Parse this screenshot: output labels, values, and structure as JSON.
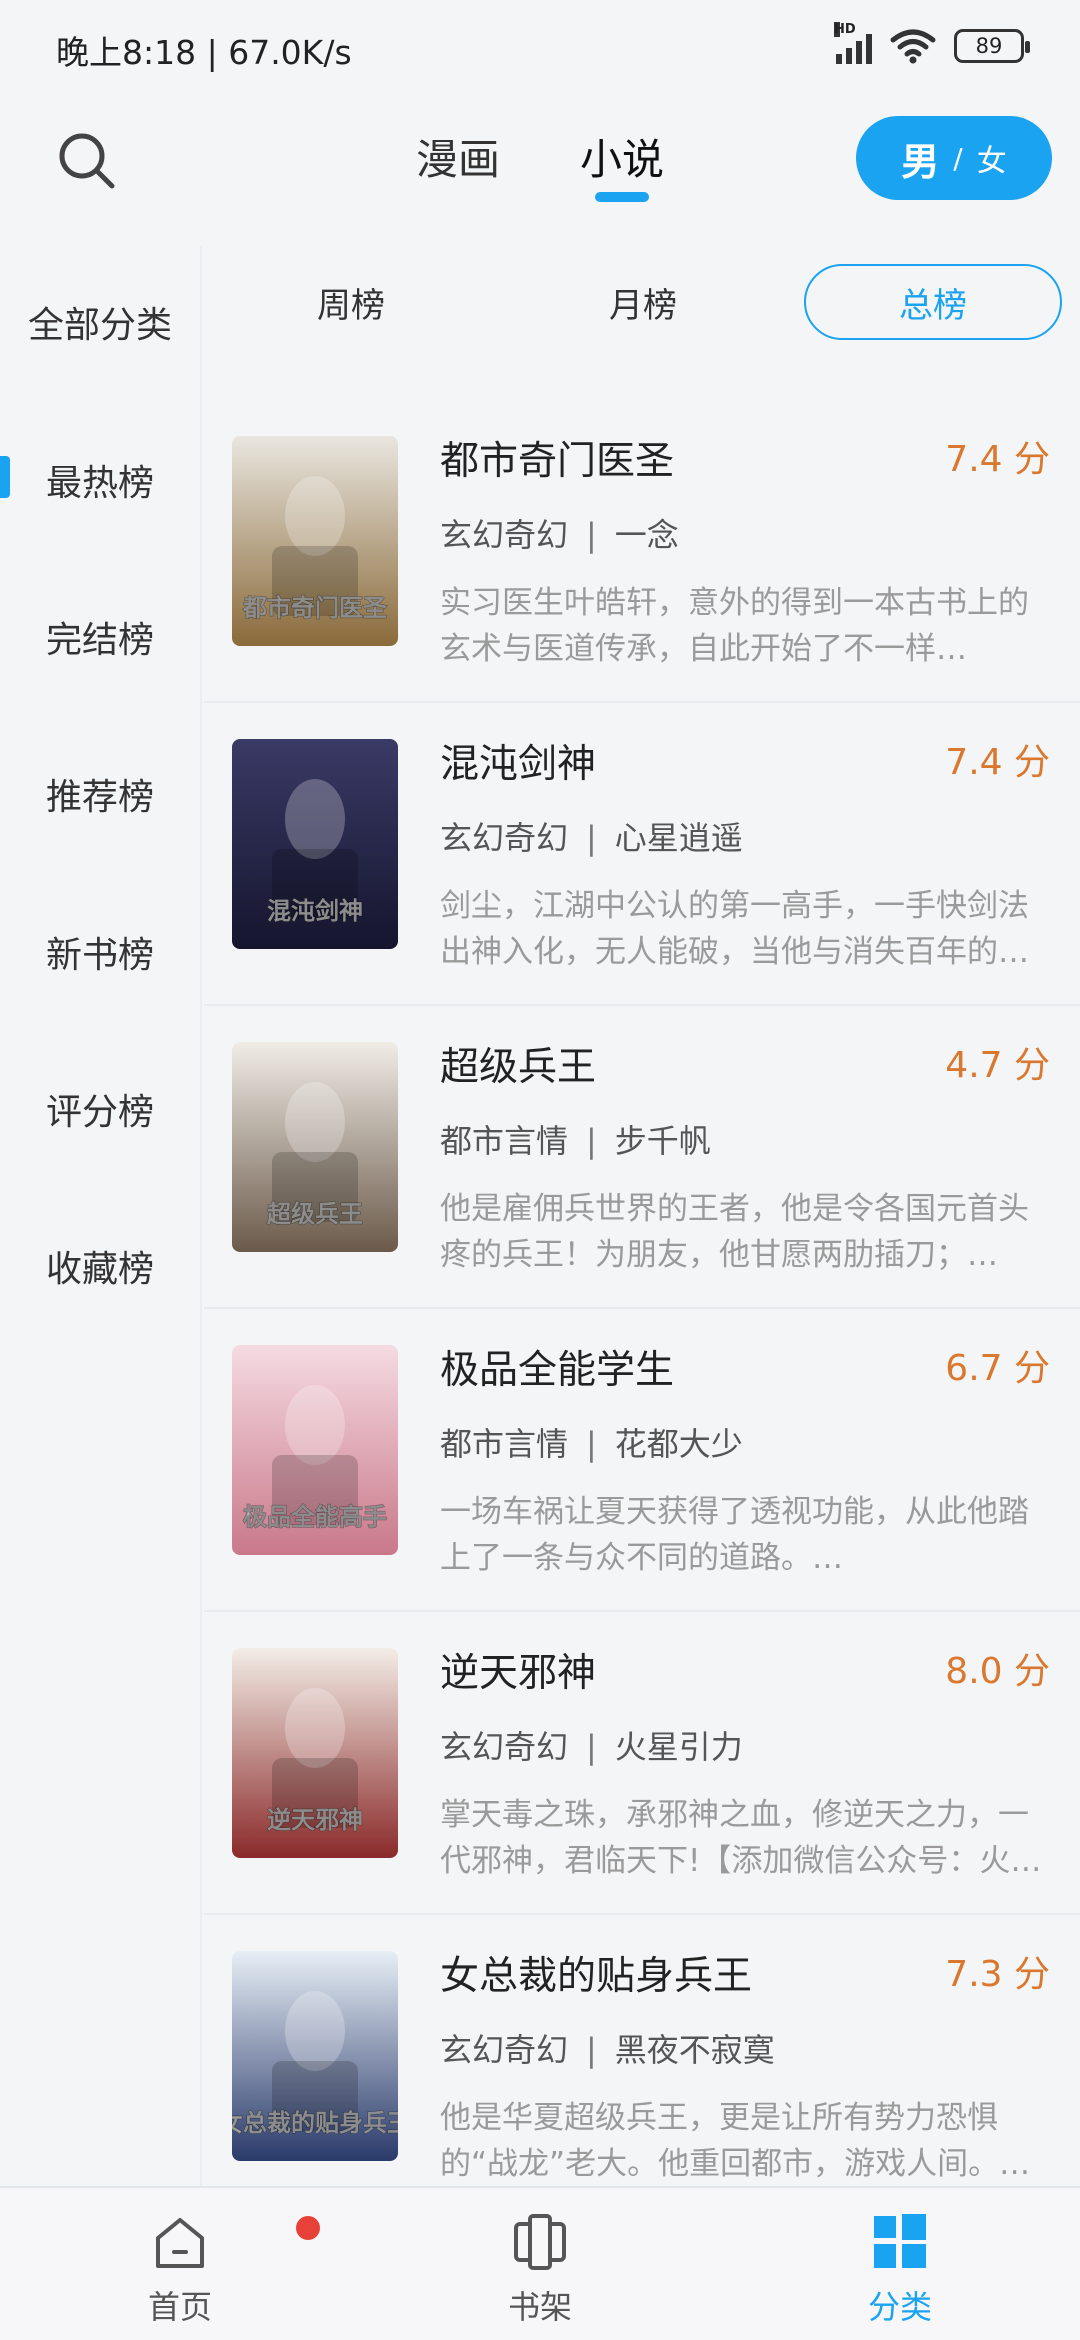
{
  "status_bar": {
    "time_speed": "晚上8:18 | 67.0K/s",
    "signal_badge": "HD",
    "battery": "89"
  },
  "header": {
    "tabs": [
      {
        "label": "漫画"
      },
      {
        "label": "小说"
      }
    ],
    "gender_toggle": {
      "male": "男",
      "separator": "/",
      "female": "女"
    }
  },
  "sidebar": {
    "items": [
      {
        "label": "全部分类"
      },
      {
        "label": "最热榜"
      },
      {
        "label": "完结榜"
      },
      {
        "label": "推荐榜"
      },
      {
        "label": "新书榜"
      },
      {
        "label": "评分榜"
      },
      {
        "label": "收藏榜"
      }
    ],
    "active_index": 1
  },
  "periods": [
    {
      "label": "周榜"
    },
    {
      "label": "月榜"
    },
    {
      "label": "总榜"
    }
  ],
  "active_period": 2,
  "books": [
    {
      "title": "都市奇门医圣",
      "score": "7.4 分",
      "genre": "玄幻奇幻",
      "separator": "|",
      "author": "一念",
      "desc": "实习医生叶皓轩，意外的得到一本古书上的玄术与医道传承，自此开始了不一样…",
      "cover_text": "都市奇门医圣",
      "cover_colors": [
        "#e9e6df",
        "#8a6a3a"
      ]
    },
    {
      "title": "混沌剑神",
      "score": "7.4 分",
      "genre": "玄幻奇幻",
      "separator": "|",
      "author": "心星逍遥",
      "desc": "剑尘，江湖中公认的第一高手，一手快剑法出神入化，无人能破，当他与消失百年的…",
      "cover_text": "混沌剑神",
      "cover_colors": [
        "#3a3a66",
        "#15152e"
      ]
    },
    {
      "title": "超级兵王",
      "score": "4.7 分",
      "genre": "都市言情",
      "separator": "|",
      "author": "步千帆",
      "desc": "他是雇佣兵世界的王者，他是令各国元首头疼的兵王！为朋友，他甘愿两肋插刀；…",
      "cover_text": "超级兵王",
      "cover_colors": [
        "#f0ece6",
        "#6b5a4a"
      ]
    },
    {
      "title": "极品全能学生",
      "score": "6.7 分",
      "genre": "都市言情",
      "separator": "|",
      "author": "花都大少",
      "desc": "一场车祸让夏天获得了透视功能，从此他踏上了一条与众不同的道路。…",
      "cover_text": "极品全能高手",
      "cover_colors": [
        "#f5dbe2",
        "#c9788a"
      ]
    },
    {
      "title": "逆天邪神",
      "score": "8.0 分",
      "genre": "玄幻奇幻",
      "separator": "|",
      "author": "火星引力",
      "desc": "掌天毒之珠，承邪神之血，修逆天之力，一代邪神，君临天下!【添加微信公众号：火…",
      "cover_text": "逆天邪神",
      "cover_colors": [
        "#f3ede6",
        "#8a2a2a"
      ]
    },
    {
      "title": "女总裁的贴身兵王",
      "score": "7.3 分",
      "genre": "玄幻奇幻",
      "separator": "|",
      "author": "黑夜不寂寞",
      "desc": "他是华夏超级兵王，更是让所有势力恐惧的“战龙”老大。他重回都市，游戏人间。…",
      "cover_text": "女总裁的贴身兵王",
      "cover_colors": [
        "#e6eef5",
        "#2a3a6a"
      ]
    }
  ],
  "bottom_nav": [
    {
      "label": "首页",
      "icon": "home-icon"
    },
    {
      "label": "书架",
      "icon": "bookshelf-icon"
    },
    {
      "label": "分类",
      "icon": "category-grid-icon"
    }
  ],
  "bottom_nav_active": 2,
  "accent_color": "#1aa3f0",
  "score_color": "#d9782e"
}
